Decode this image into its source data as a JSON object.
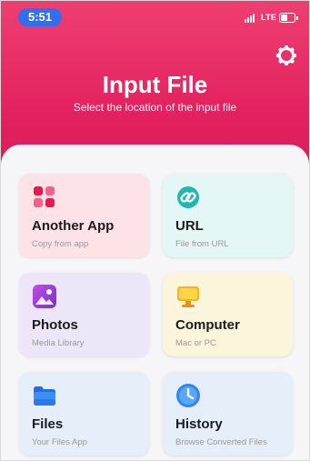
{
  "status_bar": {
    "time": "5:51",
    "network": "LTE"
  },
  "header": {
    "title": "Input File",
    "subtitle": "Select the location of the input file",
    "settings_icon": "gear-icon"
  },
  "colors": {
    "accent": "#e3225f",
    "time_pill": "#2f6ff0"
  },
  "sources": [
    {
      "title": "Another App",
      "subtitle": "Copy from app",
      "icon": "apps-grid-icon",
      "bg": "#fde3e8"
    },
    {
      "title": "URL",
      "subtitle": "File from URL",
      "icon": "link-icon",
      "bg": "#e5f6f6"
    },
    {
      "title": "Photos",
      "subtitle": "Media Library",
      "icon": "photo-icon",
      "bg": "#ede6f8"
    },
    {
      "title": "Computer",
      "subtitle": "Mac or PC",
      "icon": "monitor-icon",
      "bg": "#fbf5db"
    },
    {
      "title": "Files",
      "subtitle": "Your Files App",
      "icon": "folder-icon",
      "bg": "#e5eef9"
    },
    {
      "title": "History",
      "subtitle": "Browse Converted Files",
      "icon": "clock-icon",
      "bg": "#e5eef9"
    }
  ]
}
